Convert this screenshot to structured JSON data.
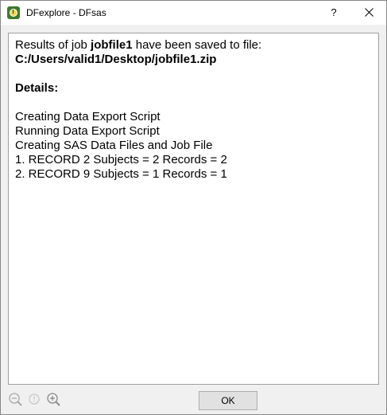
{
  "window": {
    "title": "DFexplore - DFsas",
    "help_label": "?",
    "icons": {
      "app": "clock-icon",
      "close": "close-icon"
    }
  },
  "message": {
    "intro_prefix": "Results of job ",
    "job_name": "jobfile1",
    "intro_suffix": " have been saved to file:",
    "file_path": "C:/Users/valid1/Desktop/jobfile1.zip",
    "details_heading": "Details:",
    "details": [
      "Creating Data Export Script",
      "Running Data Export Script",
      "Creating SAS Data Files and Job File",
      "1. RECORD 2 Subjects = 2 Records = 2",
      "2. RECORD 9 Subjects = 1 Records = 1"
    ]
  },
  "footer": {
    "ok_label": "OK",
    "zoom_icons": [
      "zoom-out-icon",
      "zoom-reset-icon",
      "zoom-in-icon"
    ]
  }
}
